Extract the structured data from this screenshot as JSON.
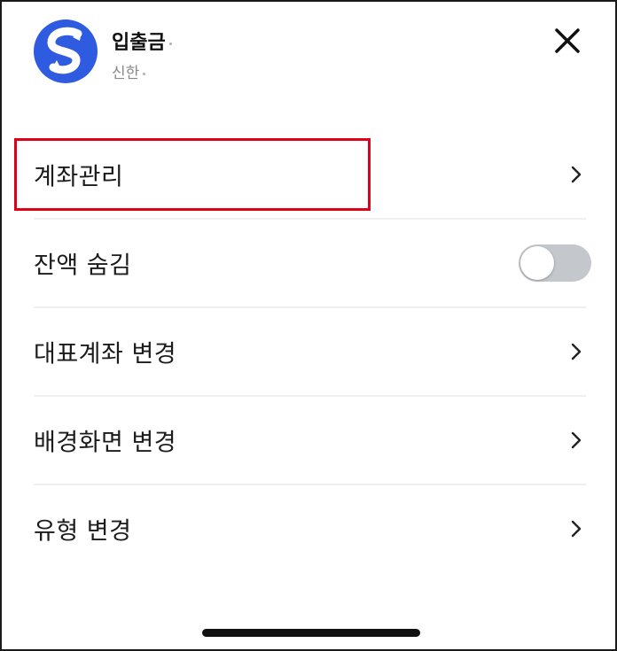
{
  "header": {
    "account_name": "입출금",
    "bank_name": "신한",
    "logo": "shinhan-logo-icon",
    "close": "close-icon"
  },
  "menu": {
    "items": [
      {
        "label": "계좌관리",
        "control": "chevron-right-icon",
        "highlighted": true
      },
      {
        "label": "잔액 숨김",
        "control": "toggle",
        "toggle_on": false
      },
      {
        "label": "대표계좌 변경",
        "control": "chevron-right-icon"
      },
      {
        "label": "배경화면 변경",
        "control": "chevron-right-icon"
      },
      {
        "label": "유형 변경",
        "control": "chevron-right-icon"
      }
    ]
  },
  "colors": {
    "logo_blue": "#2F5BE0",
    "highlight_red": "#E0001A",
    "toggle_off": "#C4C7CC",
    "secondary_text": "#8A8A8A"
  }
}
